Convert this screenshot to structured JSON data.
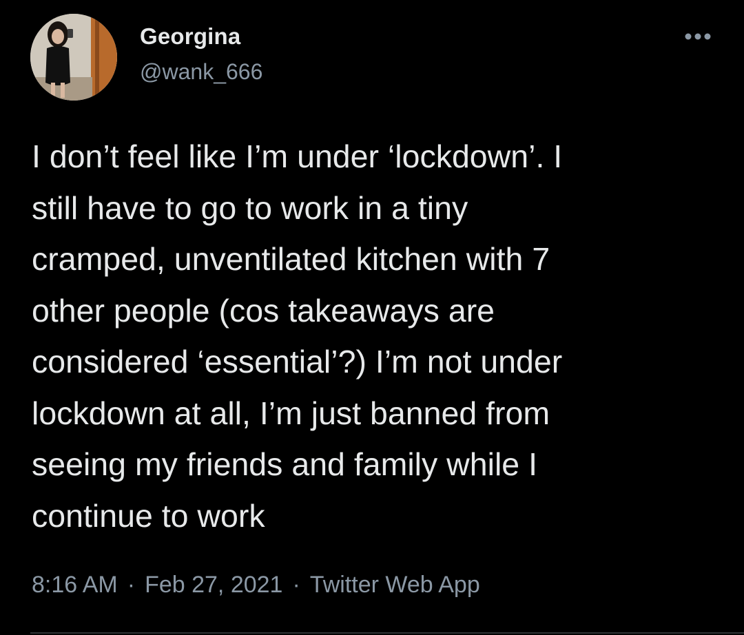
{
  "theme": {
    "background": "#000000",
    "text_primary": "#e7e9ea",
    "text_secondary": "#8b98a5",
    "divider": "#2f3336"
  },
  "tweet": {
    "author": {
      "display_name": "Georgina",
      "handle": "@wank_666",
      "avatar_icon": "profile-photo"
    },
    "more_icon": "more-horizontal-icon",
    "text": "I don’t feel like I’m under ‘lockdown’. I\nstill have to go to work in a tiny\ncramped, unventilated kitchen with 7\nother people (cos takeaways are\nconsidered ‘essential’?) I’m not under\nlockdown at all, I’m just banned from\nseeing my friends and family while I\ncontinue to work",
    "time": "8:16 AM",
    "separator": "·",
    "date": "Feb 27, 2021",
    "source": "Twitter Web App"
  }
}
